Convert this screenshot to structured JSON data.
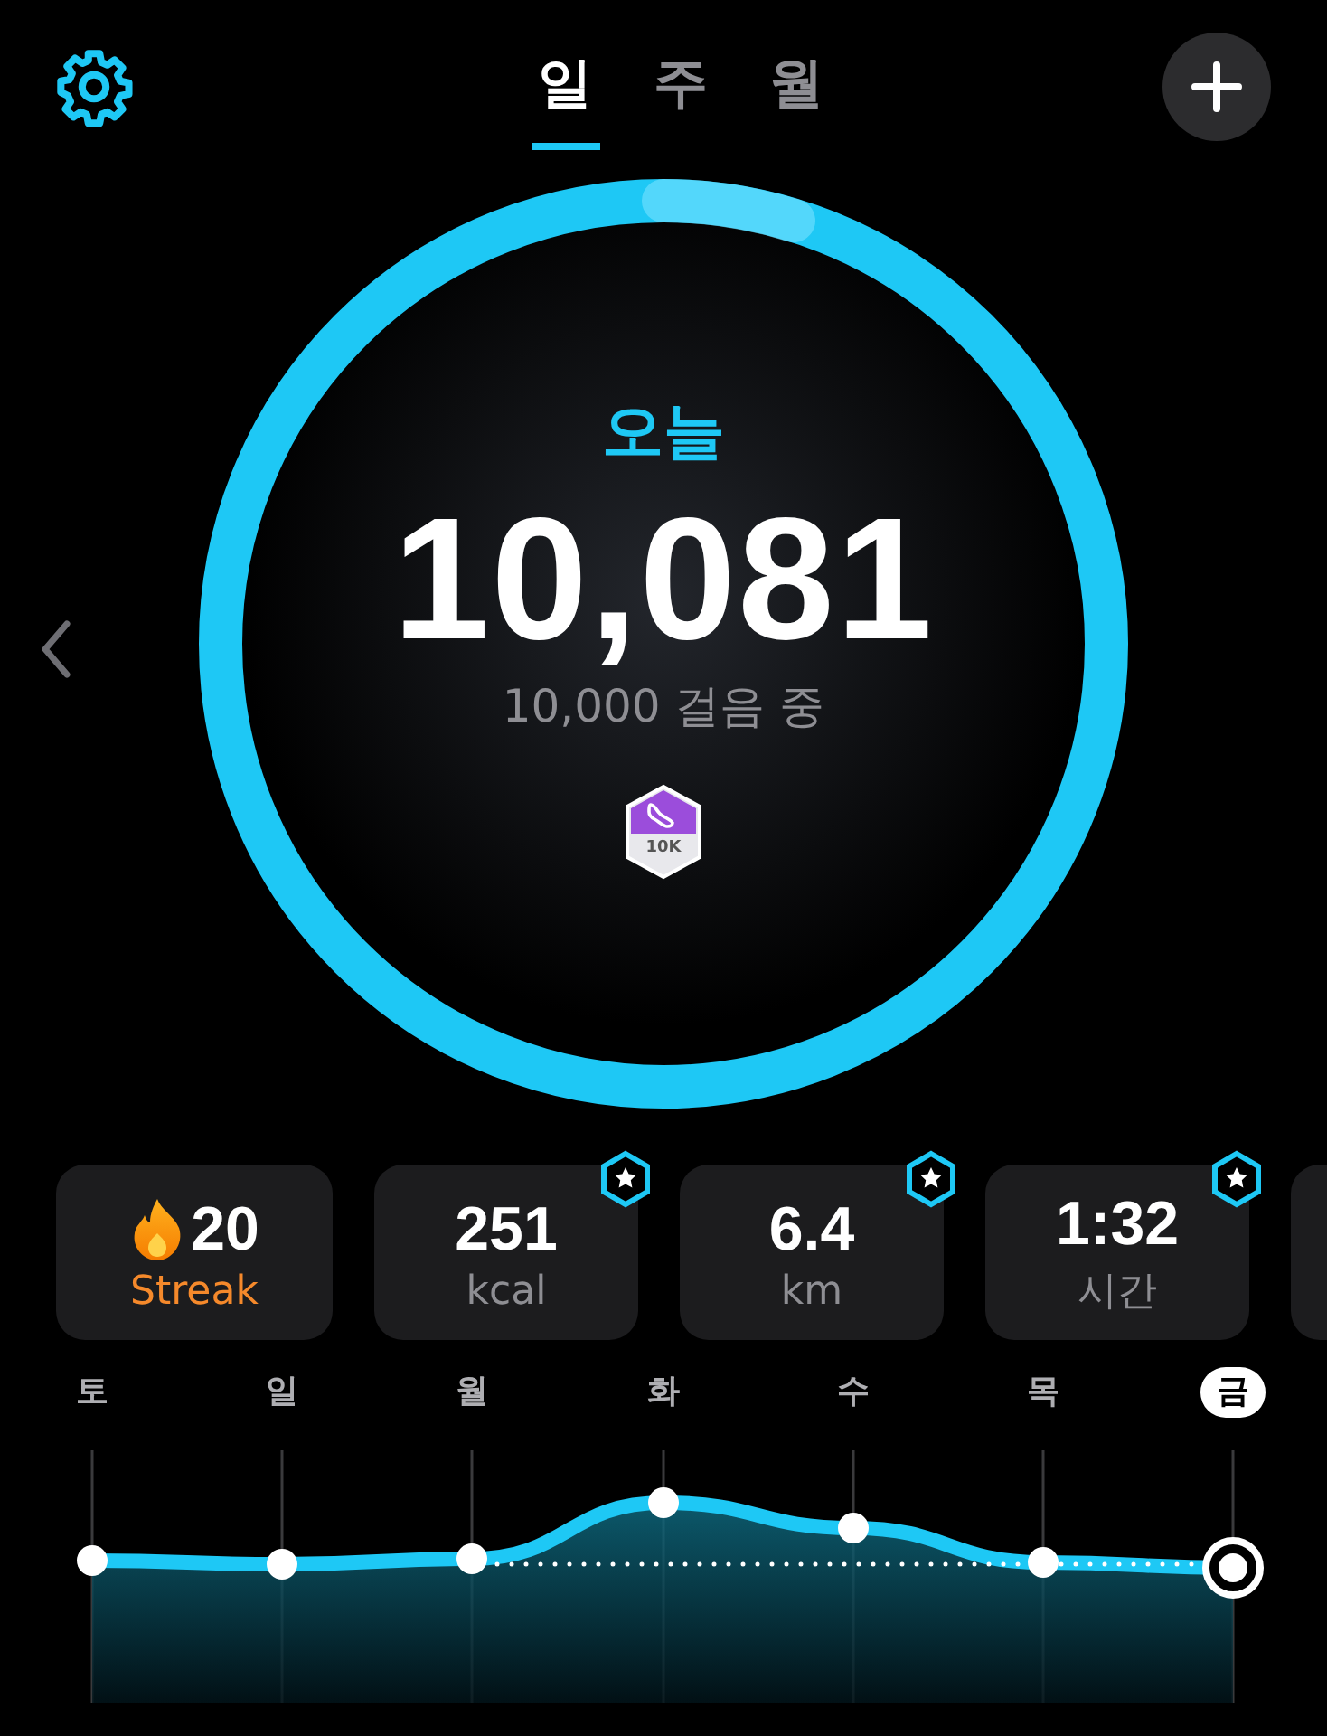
{
  "header": {
    "tabs": [
      {
        "label": "일",
        "selected": true
      },
      {
        "label": "주",
        "selected": false
      },
      {
        "label": "월",
        "selected": false
      }
    ]
  },
  "ring": {
    "title": "오늘",
    "steps": "10,081",
    "goal": "10,000 걸음 중",
    "badge": "10K"
  },
  "stats": [
    {
      "kind": "streak",
      "value": "20",
      "label": "Streak"
    },
    {
      "kind": "metric",
      "value": "251",
      "label": "kcal",
      "starred": true
    },
    {
      "kind": "metric",
      "value": "6.4",
      "label": "km",
      "starred": true
    },
    {
      "kind": "metric",
      "value": "1:32",
      "label": "시간",
      "starred": true
    },
    {
      "kind": "partial"
    }
  ],
  "week": {
    "days": [
      {
        "label": "토",
        "selected": false
      },
      {
        "label": "일",
        "selected": false
      },
      {
        "label": "월",
        "selected": false
      },
      {
        "label": "화",
        "selected": false
      },
      {
        "label": "수",
        "selected": false
      },
      {
        "label": "목",
        "selected": false
      },
      {
        "label": "금",
        "selected": true
      }
    ]
  }
}
